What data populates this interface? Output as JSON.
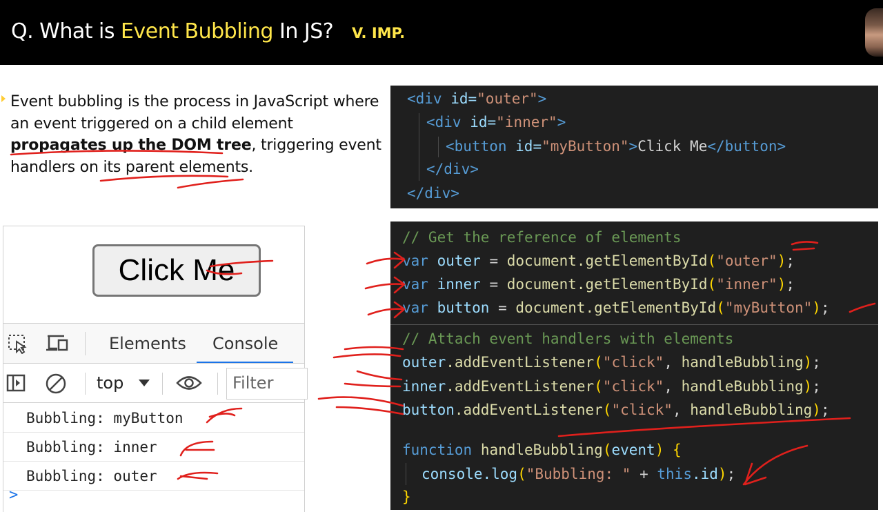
{
  "header": {
    "title_prefix": "Q. What is ",
    "title_highlight": "Event Bubbling",
    "title_suffix": " In JS?",
    "badge": "V. IMP."
  },
  "description": {
    "part1": "Event bubbling is the process in JavaScript where an event triggered on a child element ",
    "bold": "propagates up the DOM tree",
    "part2": ", triggering event handlers on its parent elements."
  },
  "html_code": {
    "outer_open": [
      "<div ",
      "id=",
      "\"outer\"",
      ">"
    ],
    "inner_open": [
      "<div ",
      "id=",
      "\"inner\"",
      ">"
    ],
    "button_line": [
      "<button ",
      "id=",
      "\"myButton\"",
      ">",
      "Click Me",
      "</button>"
    ],
    "inner_close": "</div>",
    "outer_close": "</div>"
  },
  "js_code": {
    "comment1": "// Get the reference of elements",
    "lines_vars": [
      {
        "kw": "var",
        "name": "outer",
        "id": "\"outer\""
      },
      {
        "kw": "var",
        "name": "inner",
        "id": "\"inner\""
      },
      {
        "kw": "var",
        "name": "button",
        "id": "\"myButton\""
      }
    ],
    "get_by_id": "document.getElementById",
    "comment2": "// Attach event handlers with elements",
    "listeners": [
      {
        "obj": "outer",
        "event": "\"click\"",
        "handler": "handleBubbling"
      },
      {
        "obj": "inner",
        "event": "\"click\"",
        "handler": "handleBubbling"
      },
      {
        "obj": "button",
        "event": "\"click\"",
        "handler": "handleBubbling"
      }
    ],
    "add_listener": ".addEventListener",
    "fn_kw": "function",
    "fn_name": "handleBubbling",
    "fn_param": "event",
    "log_call": "console.log",
    "log_str": "\"Bubbling: \"",
    "log_rest": " + ",
    "this_kw": "this",
    "this_prop": ".id",
    "close_brace": "}"
  },
  "browser": {
    "button_label": "Click Me",
    "devtools": {
      "tabs": [
        "Elements",
        "Console"
      ],
      "active_tab": "Console",
      "context": "top",
      "filter_placeholder": "Filter",
      "logs": [
        "Bubbling: myButton",
        "Bubbling: inner",
        "Bubbling: outer"
      ],
      "prompt": ">"
    }
  },
  "colors": {
    "highlight": "#ffe64a",
    "ink": "#e0201c",
    "code_bg": "#1f1f1f"
  }
}
